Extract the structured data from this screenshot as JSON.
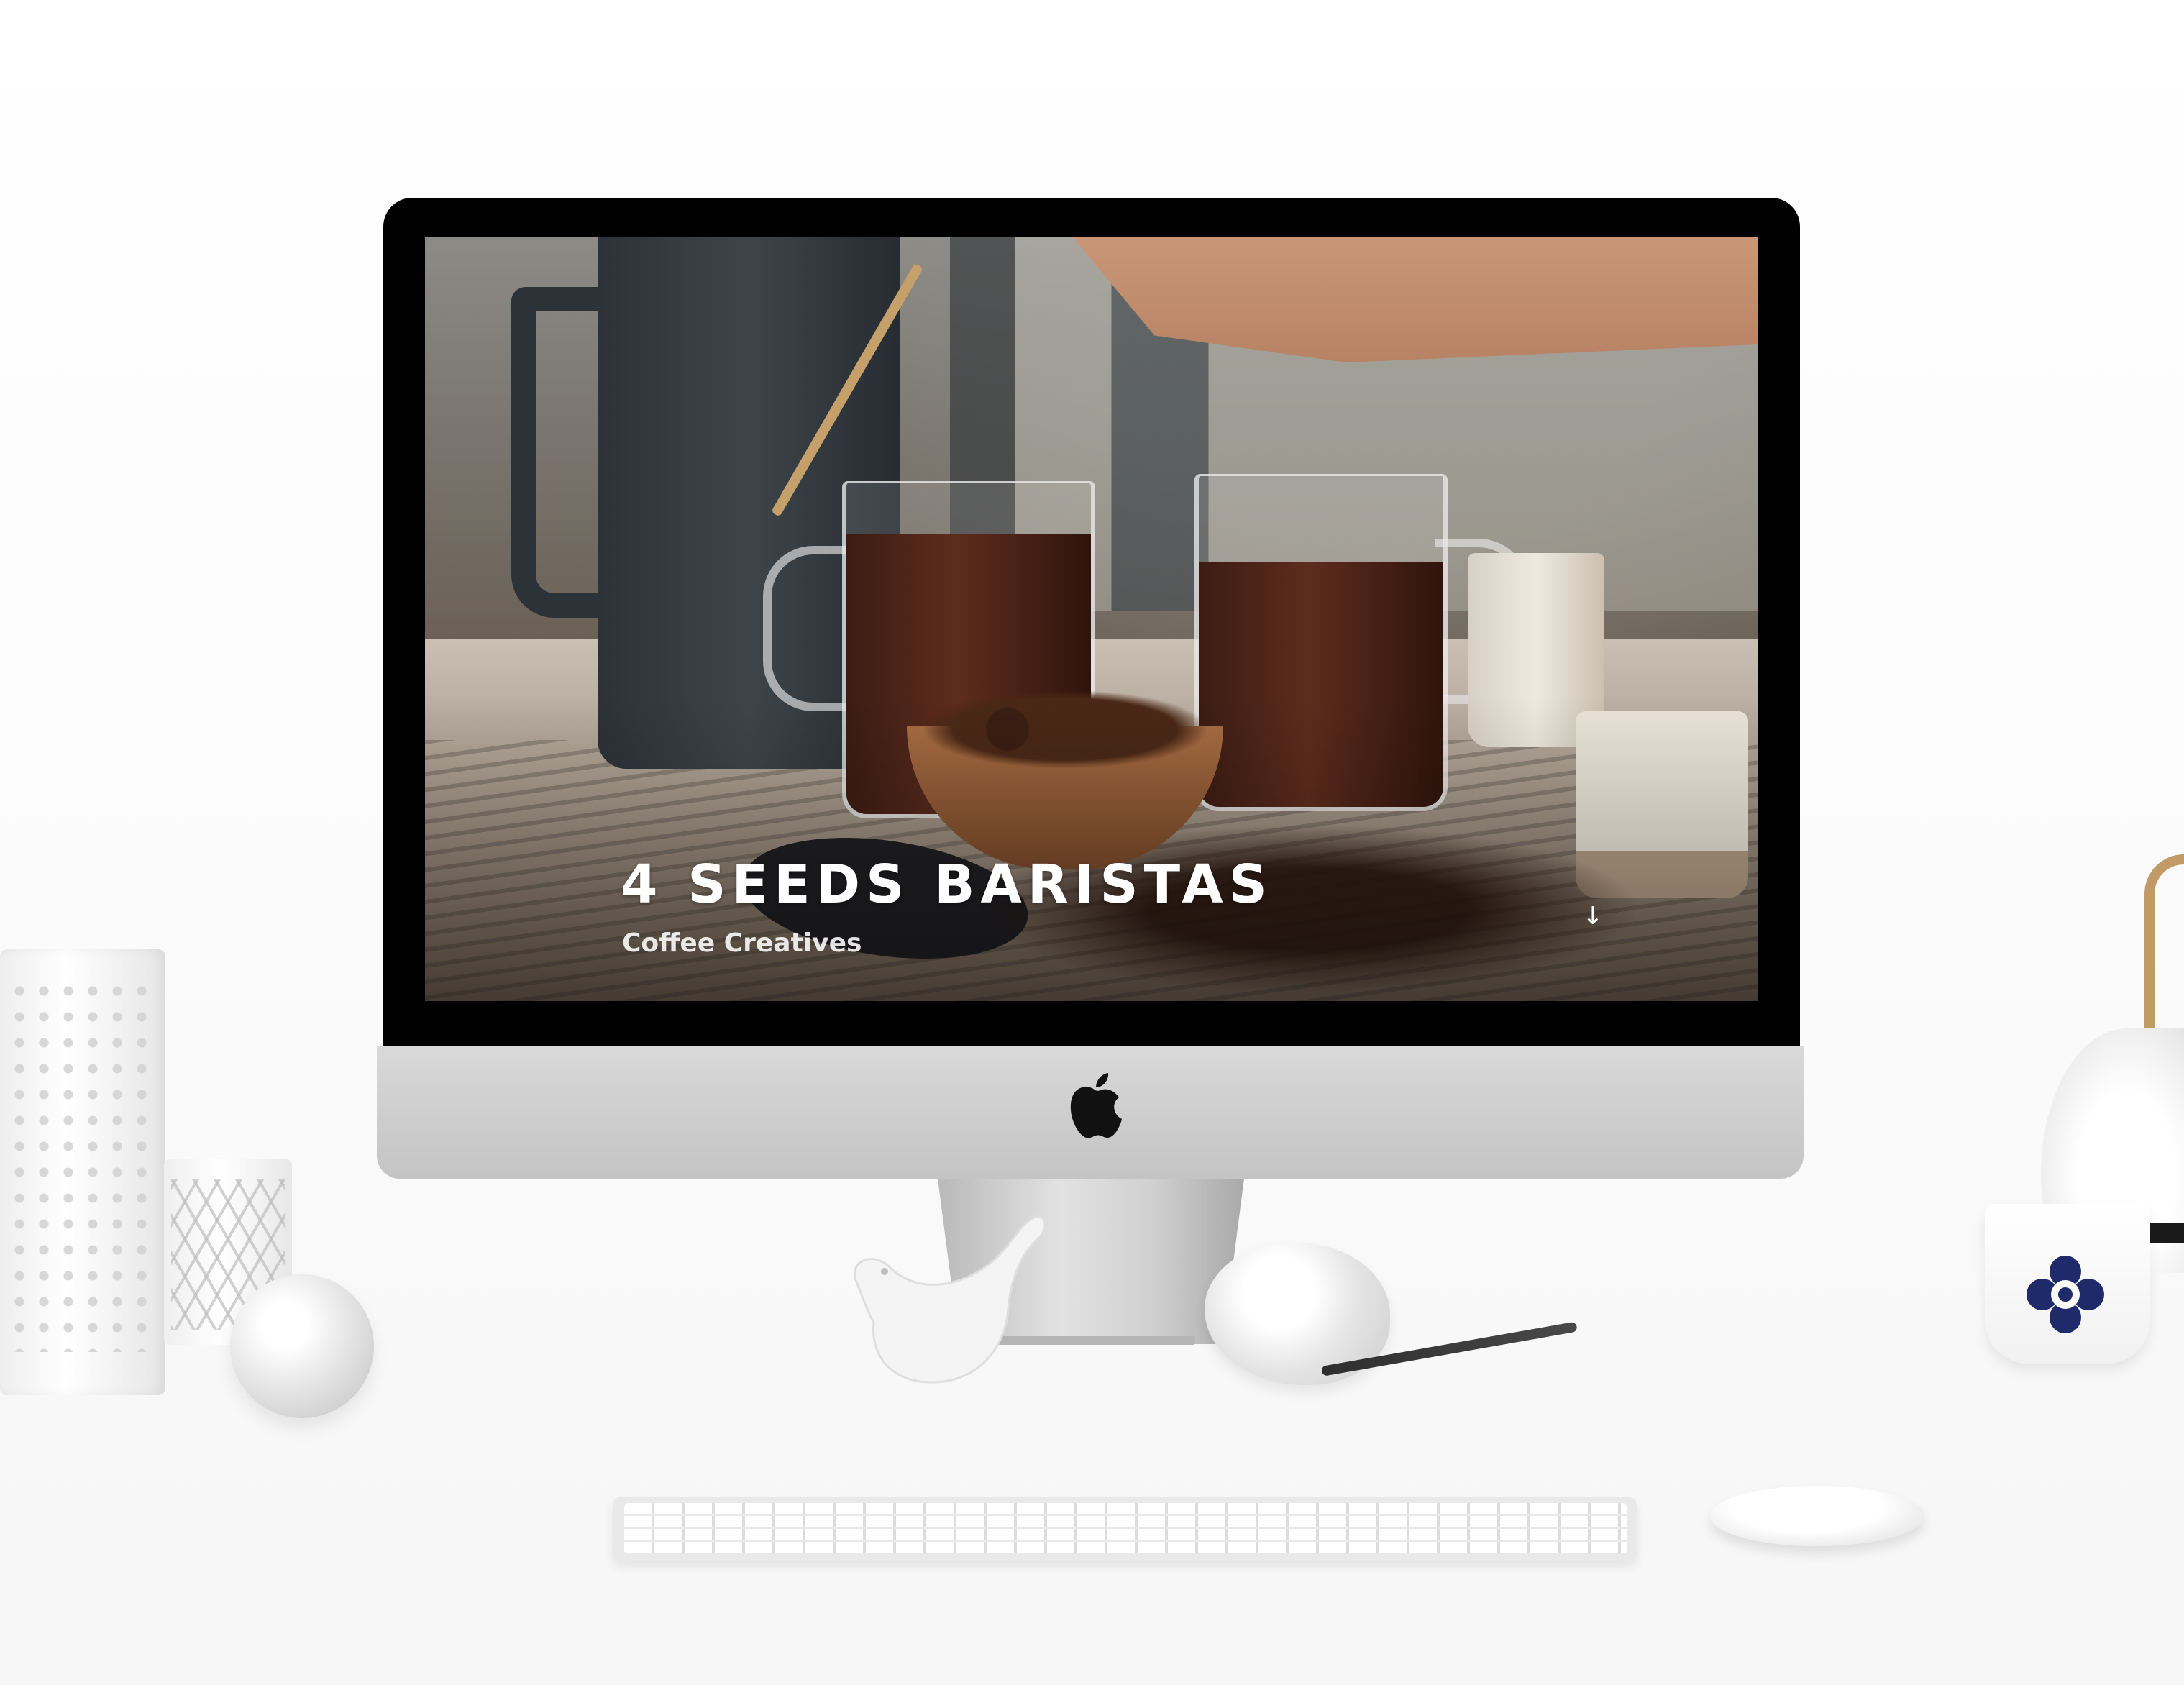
{
  "website": {
    "title": "4 SEEDS BARISTAS",
    "subtitle": "Coffee Creatives",
    "scroll_icon": "arrow-down-icon",
    "scroll_glyph": "↓"
  },
  "device": {
    "logo_icon": "apple-logo-icon"
  },
  "colors": {
    "title_text": "#ffffff",
    "bezel": "#000000",
    "aluminum": "#cfcfcf"
  }
}
